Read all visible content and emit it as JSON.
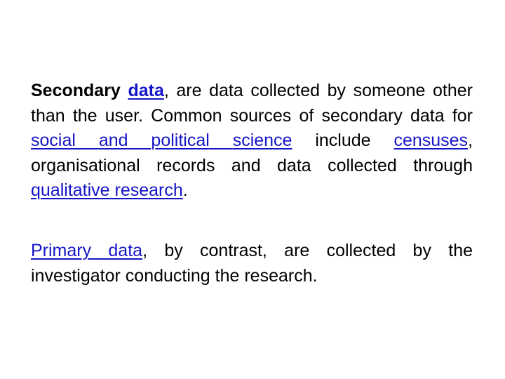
{
  "paragraph1": {
    "term": "Secondary",
    "link_data": "data",
    "text1": ", are data collected by someone other than the user. Common sources of secondary data for ",
    "link_social": "social",
    "link_and": "and",
    "link_political": "political",
    "link_science": "science",
    "text2": " include ",
    "link_censuses": "censuses",
    "text3": ", organisational records and data collected through ",
    "link_qualitative_research": "qualitative research",
    "text4": "."
  },
  "paragraph2": {
    "link_primary": "Primary",
    "link_data": "data",
    "text1": ", by contrast, are collected by the investigator conducting the research."
  },
  "colors": {
    "text": "#000000",
    "link": "#1414c8",
    "background": "#ffffff"
  }
}
